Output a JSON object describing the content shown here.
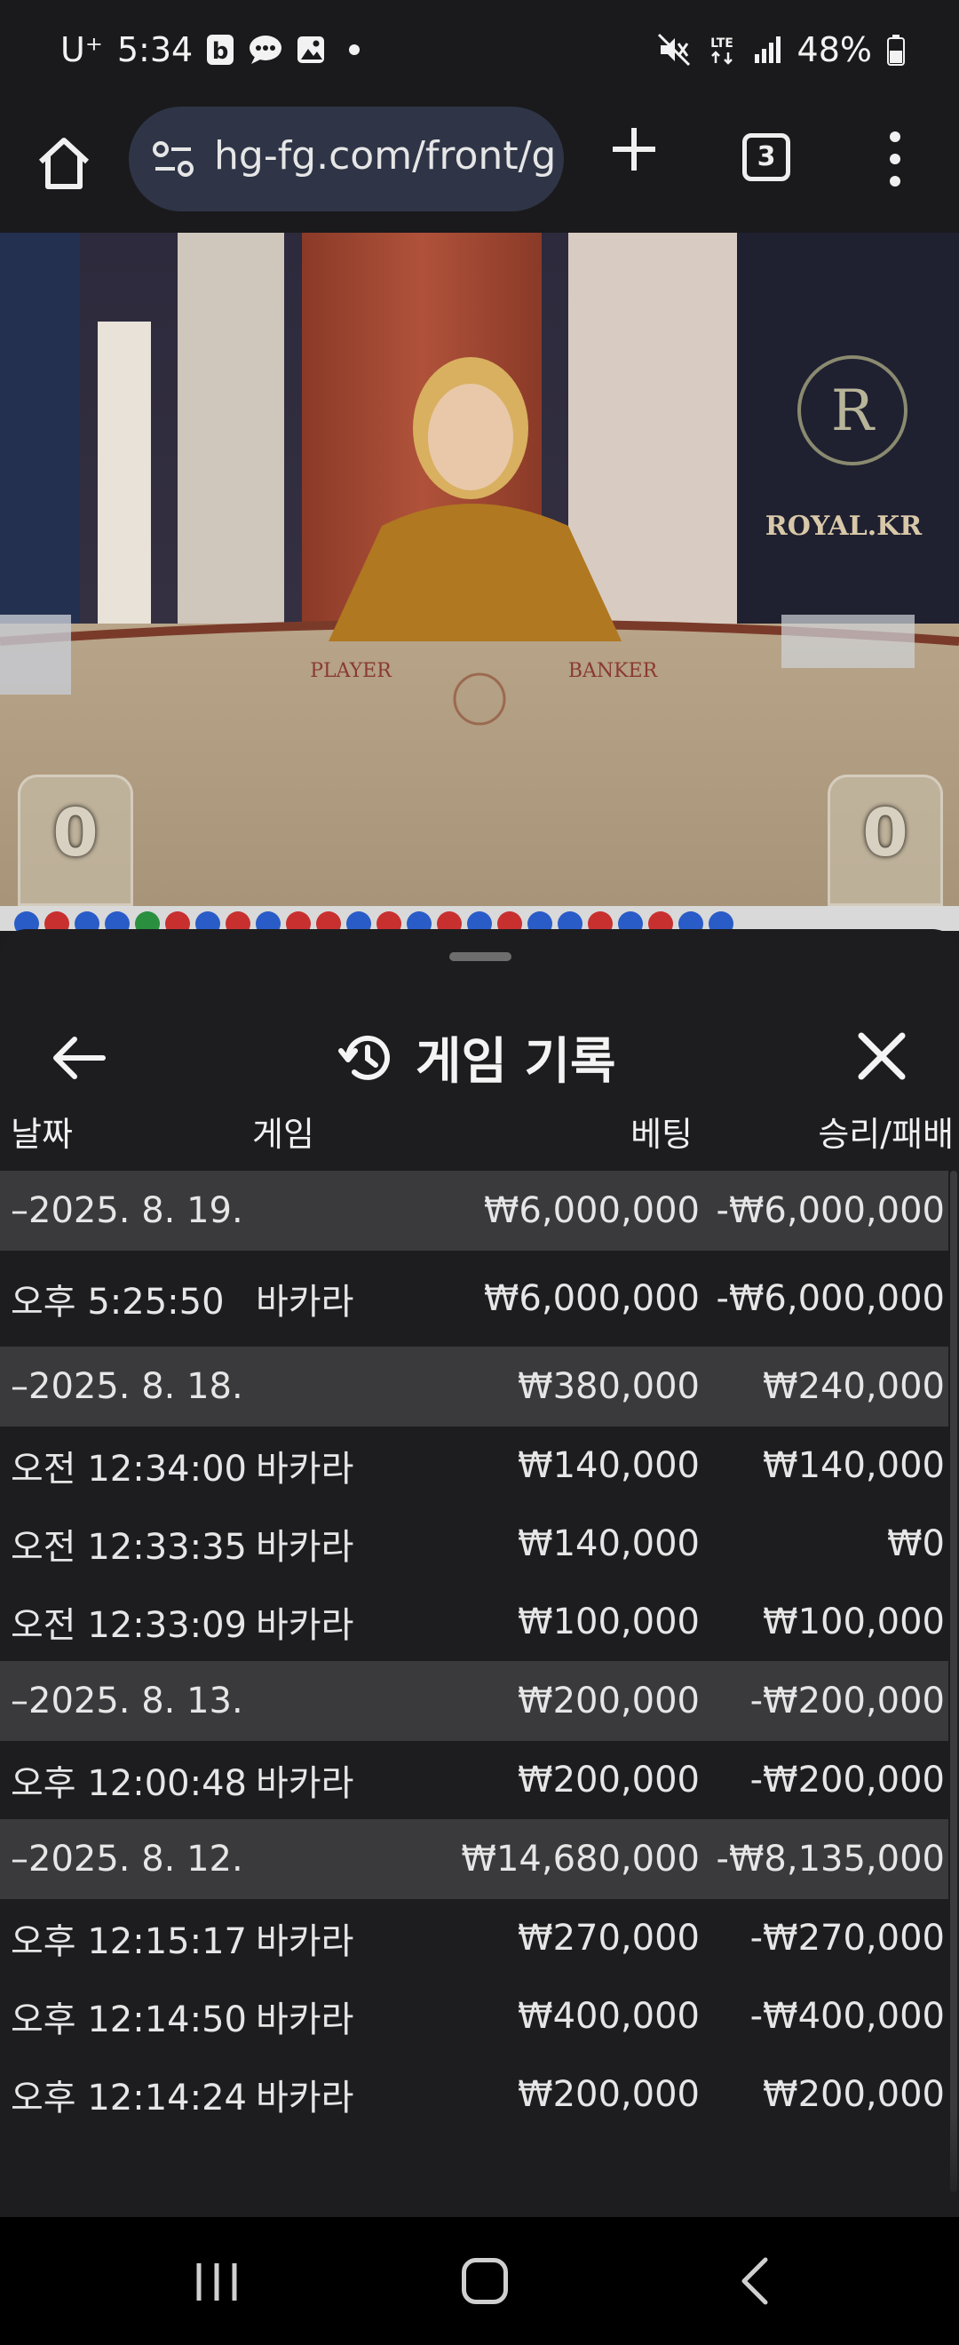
{
  "status_bar": {
    "carrier": "U⁺",
    "time": "5:34",
    "network": "LTE",
    "battery": "48%",
    "icons": [
      "b-app-icon",
      "chat-bubble-icon",
      "gallery-icon",
      "dot-icon",
      "mute-icon",
      "lte-icon",
      "signal-icon",
      "battery-icon"
    ]
  },
  "browser": {
    "url": "hg-fg.com/front/g",
    "tab_count": "3",
    "icons": [
      "home-icon",
      "site-settings-icon",
      "new-tab-plus-icon",
      "tab-switcher-icon",
      "more-vert-icon"
    ]
  },
  "video": {
    "table_left_label": "PLAYER",
    "table_right_label": "BANKER",
    "brand_text": "ROYAL.KR",
    "player_score": "0",
    "banker_score": "0"
  },
  "sheet": {
    "title": "게임 기록",
    "columns": {
      "date": "날짜",
      "game": "게임",
      "bet": "베팅",
      "result": "승리/패배"
    },
    "rows": [
      {
        "type": "group",
        "date": "–2025. 8. 19.",
        "game": "",
        "bet": "₩6,000,000",
        "result": "-₩6,000,000"
      },
      {
        "type": "item",
        "date": "오후 5:25:50",
        "game": "바카라",
        "bet": "₩6,000,000",
        "result": "-₩6,000,000"
      },
      {
        "type": "group",
        "date": "–2025. 8. 18.",
        "game": "",
        "bet": "₩380,000",
        "result": "₩240,000"
      },
      {
        "type": "item",
        "date": "오전 12:34:00",
        "game": "바카라",
        "bet": "₩140,000",
        "result": "₩140,000"
      },
      {
        "type": "item",
        "date": "오전 12:33:35",
        "game": "바카라",
        "bet": "₩140,000",
        "result": "₩0"
      },
      {
        "type": "item",
        "date": "오전 12:33:09",
        "game": "바카라",
        "bet": "₩100,000",
        "result": "₩100,000"
      },
      {
        "type": "group",
        "date": "–2025. 8. 13.",
        "game": "",
        "bet": "₩200,000",
        "result": "-₩200,000"
      },
      {
        "type": "item",
        "date": "오후 12:00:48",
        "game": "바카라",
        "bet": "₩200,000",
        "result": "-₩200,000"
      },
      {
        "type": "group",
        "date": "–2025. 8. 12.",
        "game": "",
        "bet": "₩14,680,000",
        "result": "-₩8,135,000"
      },
      {
        "type": "item",
        "date": "오후 12:15:17",
        "game": "바카라",
        "bet": "₩270,000",
        "result": "-₩270,000"
      },
      {
        "type": "item",
        "date": "오후 12:14:50",
        "game": "바카라",
        "bet": "₩400,000",
        "result": "-₩400,000"
      },
      {
        "type": "item",
        "date": "오후 12:14:24",
        "game": "바카라",
        "bet": "₩200,000",
        "result": "₩200,000"
      }
    ]
  },
  "colors": {
    "sheet_bg": "#1d1d1f",
    "group_row_bg": "#3a3a3c",
    "url_bar_bg": "#2f3547"
  }
}
